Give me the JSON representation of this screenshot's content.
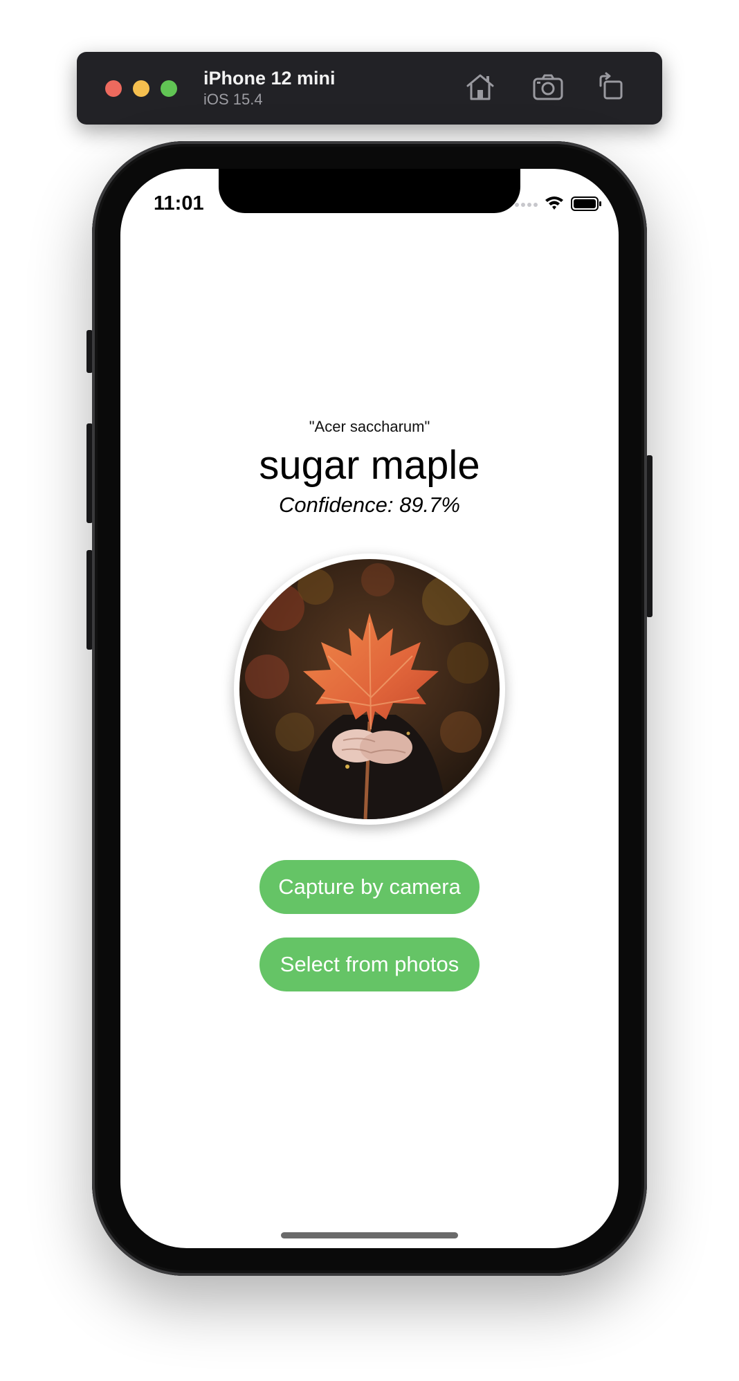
{
  "simulator": {
    "device_name": "iPhone 12 mini",
    "os_version": "iOS 15.4",
    "toolbar_icons": [
      "home-icon",
      "screenshot-camera-icon",
      "rotate-icon"
    ]
  },
  "status_bar": {
    "time": "11:01",
    "icons": [
      "cellular-dots-icon",
      "wifi-icon",
      "battery-icon"
    ]
  },
  "result": {
    "binomial": "\"Acer saccharum\"",
    "common_name": "sugar maple",
    "confidence": "Confidence: 89.7%"
  },
  "photo": {
    "subject": "maple-leaf-photo"
  },
  "buttons": {
    "camera_label": "Capture by camera",
    "photos_label": "Select from photos"
  },
  "colors": {
    "button_green": "#65c466",
    "sim_bar": "#222226",
    "light_red": "#ed6a5e",
    "light_yellow": "#f5bf4f",
    "light_green": "#61c554"
  }
}
